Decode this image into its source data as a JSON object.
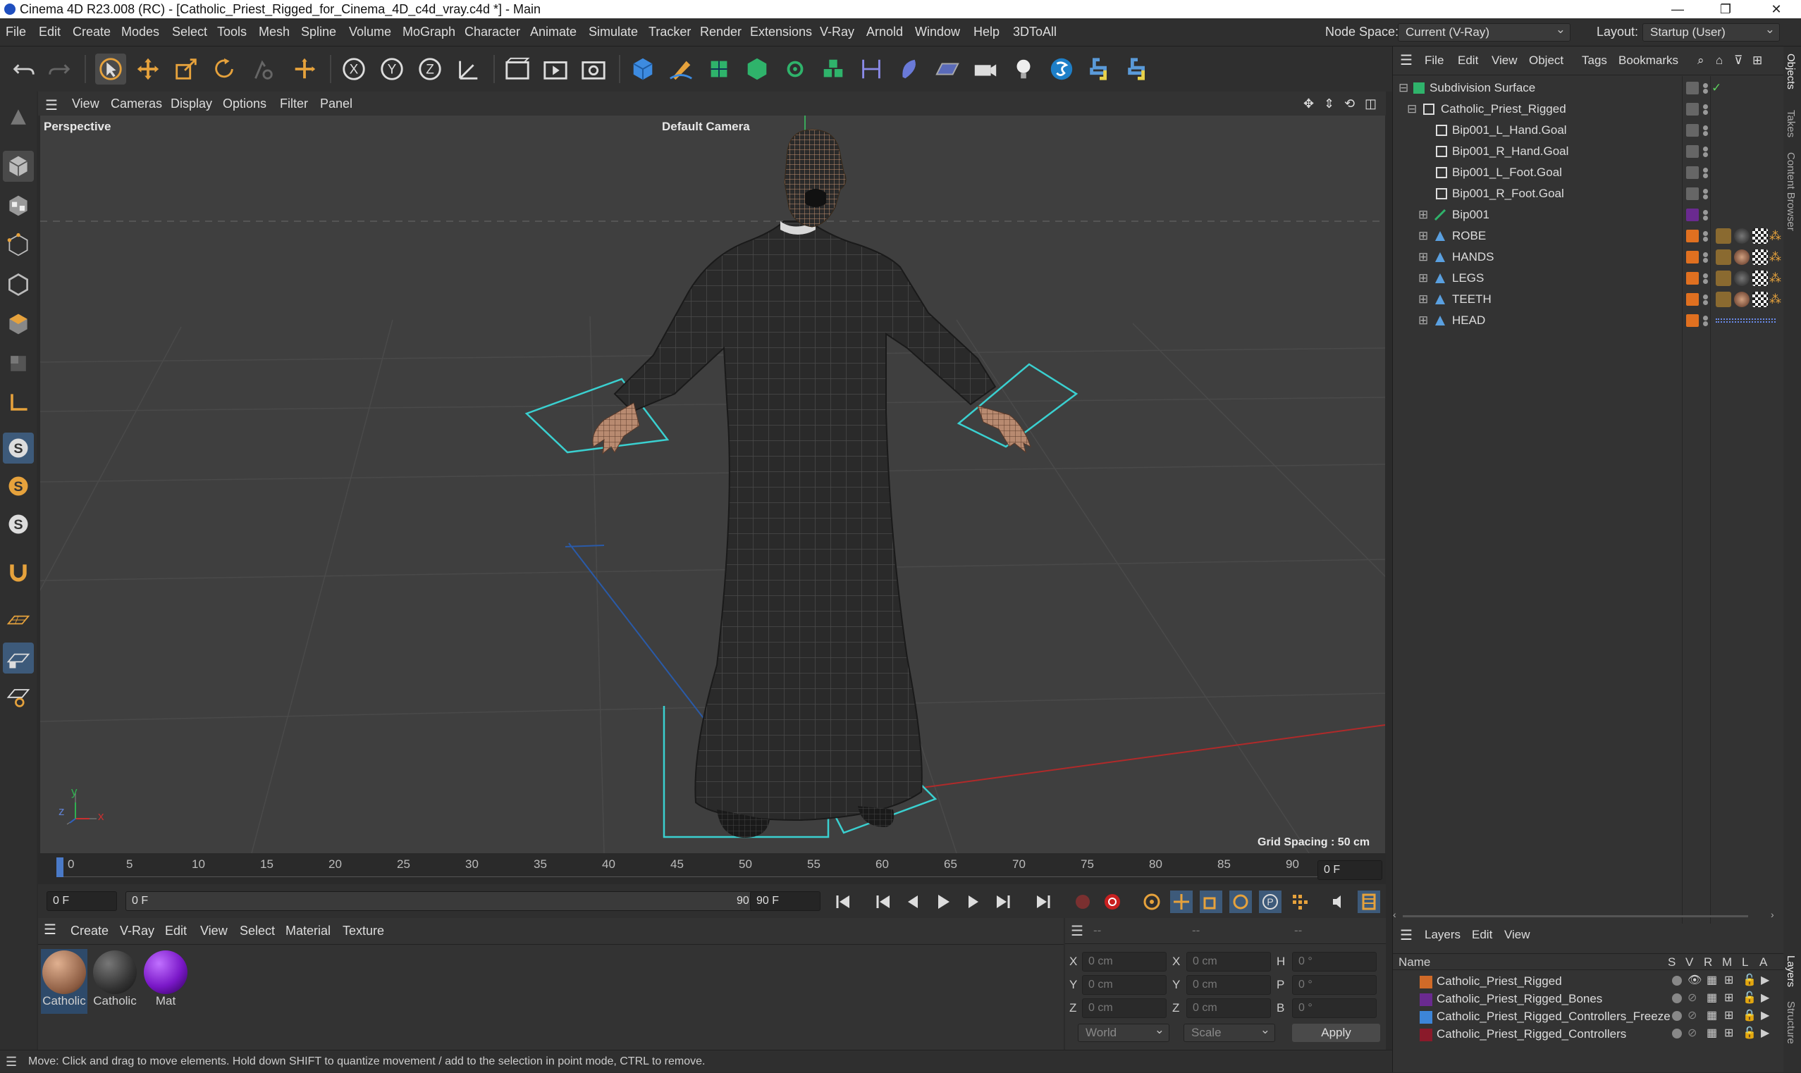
{
  "window": {
    "title": "Cinema 4D R23.008 (RC) - [Catholic_Priest_Rigged_for_Cinema_4D_c4d_vray.c4d *] - Main",
    "min": "—",
    "max": "❐",
    "close": "✕"
  },
  "menubar": {
    "items": [
      "File",
      "Edit",
      "Create",
      "Modes",
      "Select",
      "Tools",
      "Mesh",
      "Spline",
      "Volume",
      "MoGraph",
      "Character",
      "Animate",
      "Simulate",
      "Tracker",
      "Render",
      "Extensions",
      "V-Ray",
      "Arnold",
      "Window",
      "Help",
      "3DToAll"
    ],
    "node_space_label": "Node Space:",
    "node_space_value": "Current (V-Ray)",
    "layout_label": "Layout:",
    "layout_value": "Startup (User)"
  },
  "toolbar": {
    "icons": [
      "undo-icon",
      "redo-icon",
      "select-arrow-icon",
      "move-icon",
      "scale-icon",
      "rotate-icon",
      "recent-tool-icon",
      "live-select-icon",
      "axis-x-icon",
      "axis-y-icon",
      "axis-z-icon",
      "coordinate-system-icon",
      "render-view-icon",
      "render-icon",
      "render-settings-icon",
      "cube-icon",
      "pen-icon",
      "subdivision-icon",
      "extrude-icon",
      "mograph-cloner-icon",
      "array-icon",
      "symmetry-icon",
      "deformer-icon",
      "floor-icon",
      "camera-icon",
      "light-icon",
      "vray-icon",
      "python-icon",
      "python-2-icon"
    ]
  },
  "viewport": {
    "menu": [
      "View",
      "Cameras",
      "Display",
      "Options",
      "Filter",
      "Panel"
    ],
    "view_name": "Perspective",
    "camera_name": "Default Camera",
    "grid_spacing": "Grid Spacing : 50 cm",
    "axis_x": "x",
    "axis_y": "y",
    "axis_z": "z"
  },
  "timeline": {
    "ticks": [
      "0",
      "5",
      "10",
      "15",
      "20",
      "25",
      "30",
      "35",
      "40",
      "45",
      "50",
      "55",
      "60",
      "65",
      "70",
      "75",
      "80",
      "85",
      "90"
    ],
    "current_frame": "0 F"
  },
  "playback": {
    "start": "0 F",
    "range_start": "0 F",
    "range_end": "90 F",
    "end": "90 F"
  },
  "material_panel": {
    "menu": [
      "Create",
      "V-Ray",
      "Edit",
      "View",
      "Select",
      "Material",
      "Texture"
    ],
    "materials": [
      {
        "name": "Catholic",
        "color": "#b98b6f"
      },
      {
        "name": "Catholic",
        "color": "#3a3a3a"
      },
      {
        "name": "Mat",
        "color": "#7a18c8"
      }
    ]
  },
  "attributes": {
    "header_a": "--",
    "header_b": "--",
    "header_c": "--",
    "rows": [
      {
        "l1": "X",
        "v1": "0 cm",
        "l2": "X",
        "v2": "0 cm",
        "l3": "H",
        "v3": "0 °"
      },
      {
        "l1": "Y",
        "v1": "0 cm",
        "l2": "Y",
        "v2": "0 cm",
        "l3": "P",
        "v3": "0 °"
      },
      {
        "l1": "Z",
        "v1": "0 cm",
        "l2": "Z",
        "v2": "0 cm",
        "l3": "B",
        "v3": "0 °"
      }
    ],
    "coord_mode": "World",
    "size_mode": "Scale",
    "apply": "Apply"
  },
  "status": "Move: Click and drag to move elements. Hold down SHIFT to quantize movement / add to the selection in point mode, CTRL to remove.",
  "objects_panel": {
    "menu": [
      "File",
      "Edit",
      "View",
      "Object",
      "Tags",
      "Bookmarks"
    ],
    "objects": [
      {
        "name": "Subdivision Surface",
        "color": "#2fb36b"
      },
      {
        "name": "Catholic_Priest_Rigged",
        "color": "#e07020"
      },
      {
        "name": "Bip001_L_Hand.Goal",
        "color": "#e07020"
      },
      {
        "name": "Bip001_R_Hand.Goal",
        "color": "#e07020"
      },
      {
        "name": "Bip001_L_Foot.Goal",
        "color": "#e07020"
      },
      {
        "name": "Bip001_R_Foot.Goal",
        "color": "#e07020"
      },
      {
        "name": "Bip001",
        "color": "#6a2a90"
      },
      {
        "name": "ROBE",
        "color": "#e07020"
      },
      {
        "name": "HANDS",
        "color": "#e07020"
      },
      {
        "name": "LEGS",
        "color": "#e07020"
      },
      {
        "name": "TEETH",
        "color": "#e07020"
      },
      {
        "name": "HEAD",
        "color": "#e07020"
      }
    ]
  },
  "layers_panel": {
    "menu": [
      "Layers",
      "Edit",
      "View"
    ],
    "columns": {
      "name": "Name",
      "s": "S",
      "v": "V",
      "r": "R",
      "m": "M",
      "l": "L",
      "a": "A"
    },
    "layers": [
      {
        "name": "Catholic_Priest_Rigged",
        "color": "#d06a28"
      },
      {
        "name": "Catholic_Priest_Rigged_Bones",
        "color": "#6a2a90"
      },
      {
        "name": "Catholic_Priest_Rigged_Controllers_Freeze",
        "color": "#3d85d8"
      },
      {
        "name": "Catholic_Priest_Rigged_Controllers",
        "color": "#8a1a2a"
      }
    ]
  },
  "side_tabs": [
    "Objects",
    "Takes",
    "Content Browser",
    "Layers",
    "Structure"
  ]
}
